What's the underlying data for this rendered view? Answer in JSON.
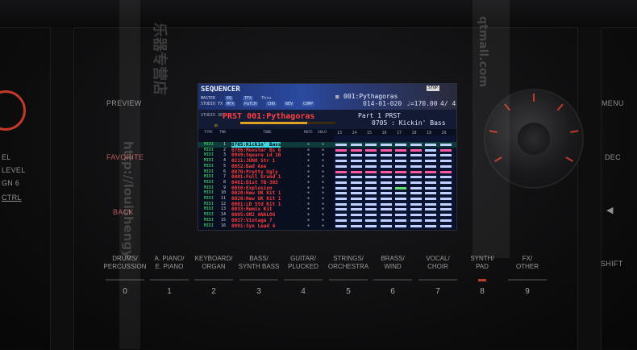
{
  "left_panel": {
    "labels": [
      "EL",
      "LEVEL",
      "GN 6",
      "CTRL"
    ],
    "buttons": [
      "PREVIEW",
      "FAVORITE",
      "BACK"
    ]
  },
  "right_panel": {
    "buttons": [
      "MENU",
      "DEC",
      "SHIFT"
    ]
  },
  "categories": [
    {
      "label": "DRUMS/\nPERCUSSION",
      "num": "0"
    },
    {
      "label": "A. PIANO/\nE. PIANO",
      "num": "1"
    },
    {
      "label": "KEYBOARD/\nORGAN",
      "num": "2"
    },
    {
      "label": "BASS/\nSYNTH BASS",
      "num": "3"
    },
    {
      "label": "GUITAR/\nPLUCKED",
      "num": "4"
    },
    {
      "label": "STRINGS/\nORCHESTRA",
      "num": "5"
    },
    {
      "label": "BRASS/\nWIND",
      "num": "6"
    },
    {
      "label": "VOCAL/\nCHOIR",
      "num": "7"
    },
    {
      "label": "SYNTH/\nPAD",
      "num": "8"
    },
    {
      "label": "FX/\nOTHER",
      "num": "9"
    }
  ],
  "lcd": {
    "title": "SEQUENCER",
    "master_label": "MASTER",
    "studiofx_label": "STUDIO FX",
    "master_pills": [
      "EQ",
      "TFX",
      "Thru"
    ],
    "studiofx_pills": [
      "MFX",
      "PaTCH",
      "CHO",
      "REV",
      "COMP"
    ],
    "stop": "STOP",
    "song": "001:Pythagoras",
    "position": "014-01-020",
    "tempo": "♩=170.00",
    "beat": "4/ 4",
    "studio_set": "STUDIO SET",
    "prst_label": "PRST",
    "prst_name": "001:Pythagoras",
    "part": "Part 1",
    "prst_tone": "PRST",
    "tone_name": "0705 : Kickin' Bass",
    "col_type": "TYPE",
    "col_trk": "TRK",
    "col_tone": "TONE",
    "col_mute": "MUTE",
    "col_solo": "SOLO",
    "measures": [
      "13",
      "14",
      "15",
      "16",
      "17",
      "18",
      "19",
      "20"
    ],
    "rows": [
      {
        "type": "MIDI",
        "trk": "1",
        "tone": "0705:Kickin' Bass"
      },
      {
        "type": "MIDI",
        "trk": "2",
        "tone": "0786:Monster Bs 6"
      },
      {
        "type": "MIDI",
        "trk": "3",
        "tone": "0949:Square Ld 10"
      },
      {
        "type": "MIDI",
        "trk": "4",
        "tone": "0211:JUNO Str 1"
      },
      {
        "type": "MIDI",
        "trk": "5",
        "tone": "0052:Bad Axe"
      },
      {
        "type": "MIDI",
        "trk": "6",
        "tone": "0870:Pretty Ugly"
      },
      {
        "type": "MIDI",
        "trk": "7",
        "tone": "0001:Full Grand 1"
      },
      {
        "type": "MIDI",
        "trk": "8",
        "tone": "0461:Dist TB-303"
      },
      {
        "type": "MIDI",
        "trk": "9",
        "tone": "0056:Explosion"
      },
      {
        "type": "MIDI",
        "trk": "10",
        "tone": "0020:New UK Kit 1"
      },
      {
        "type": "MIDI",
        "trk": "11",
        "tone": "0020:New UK Kit 1"
      },
      {
        "type": "MIDI",
        "trk": "12",
        "tone": "0001:LD Std Kit 1"
      },
      {
        "type": "MIDI",
        "trk": "13",
        "tone": "0033:Remix Kit"
      },
      {
        "type": "MIDI",
        "trk": "14",
        "tone": "0005:GM2 ANALOG"
      },
      {
        "type": "MIDI",
        "trk": "15",
        "tone": "0037:Vintage 7"
      },
      {
        "type": "MIDI",
        "trk": "16",
        "tone": "0991:Syn Lead 4"
      }
    ]
  },
  "watermark": {
    "text_1": "乐器专营店",
    "text_2": "http://louishengy",
    "text_3": "qtmall.com"
  },
  "colors": {
    "accent_red": "#c0392b",
    "tone_red": "#ff3c3c",
    "midi_green": "#3fe06a",
    "selection_cyan": "#3fd8e0"
  }
}
